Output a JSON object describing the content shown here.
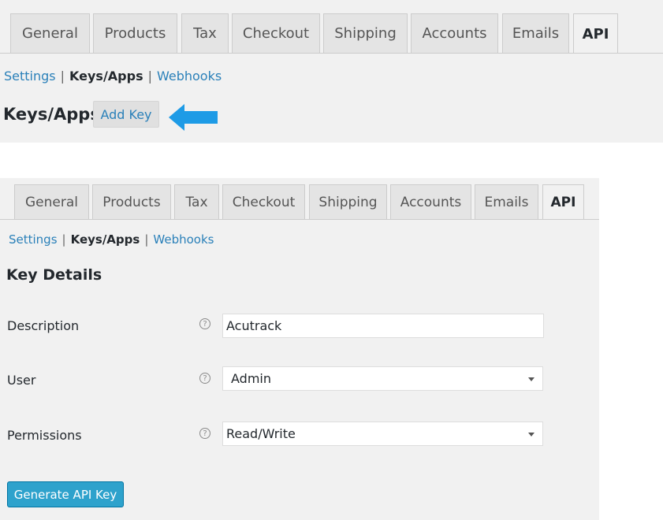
{
  "top": {
    "tabs": [
      "General",
      "Products",
      "Tax",
      "Checkout",
      "Shipping",
      "Accounts",
      "Emails",
      "API"
    ],
    "active_tab": "API",
    "subnav": {
      "settings": "Settings",
      "keys_apps": "Keys/Apps",
      "webhooks": "Webhooks"
    },
    "heading": "Keys/Apps",
    "add_key_label": "Add Key",
    "arrow_icon": "left-arrow-icon"
  },
  "bottom": {
    "tabs": [
      "General",
      "Products",
      "Tax",
      "Checkout",
      "Shipping",
      "Accounts",
      "Emails",
      "API"
    ],
    "active_tab": "API",
    "subnav": {
      "settings": "Settings",
      "keys_apps": "Keys/Apps",
      "webhooks": "Webhooks"
    },
    "heading": "Key Details",
    "fields": {
      "description": {
        "label": "Description",
        "value": "Acutrack"
      },
      "user": {
        "label": "User",
        "value": "Admin"
      },
      "permissions": {
        "label": "Permissions",
        "value": "Read/Write"
      }
    },
    "help_icon_glyph": "?",
    "generate_label": "Generate API Key"
  },
  "colors": {
    "link": "#2a80b9",
    "arrow": "#1e9be6",
    "button": "#2ea2cc"
  }
}
